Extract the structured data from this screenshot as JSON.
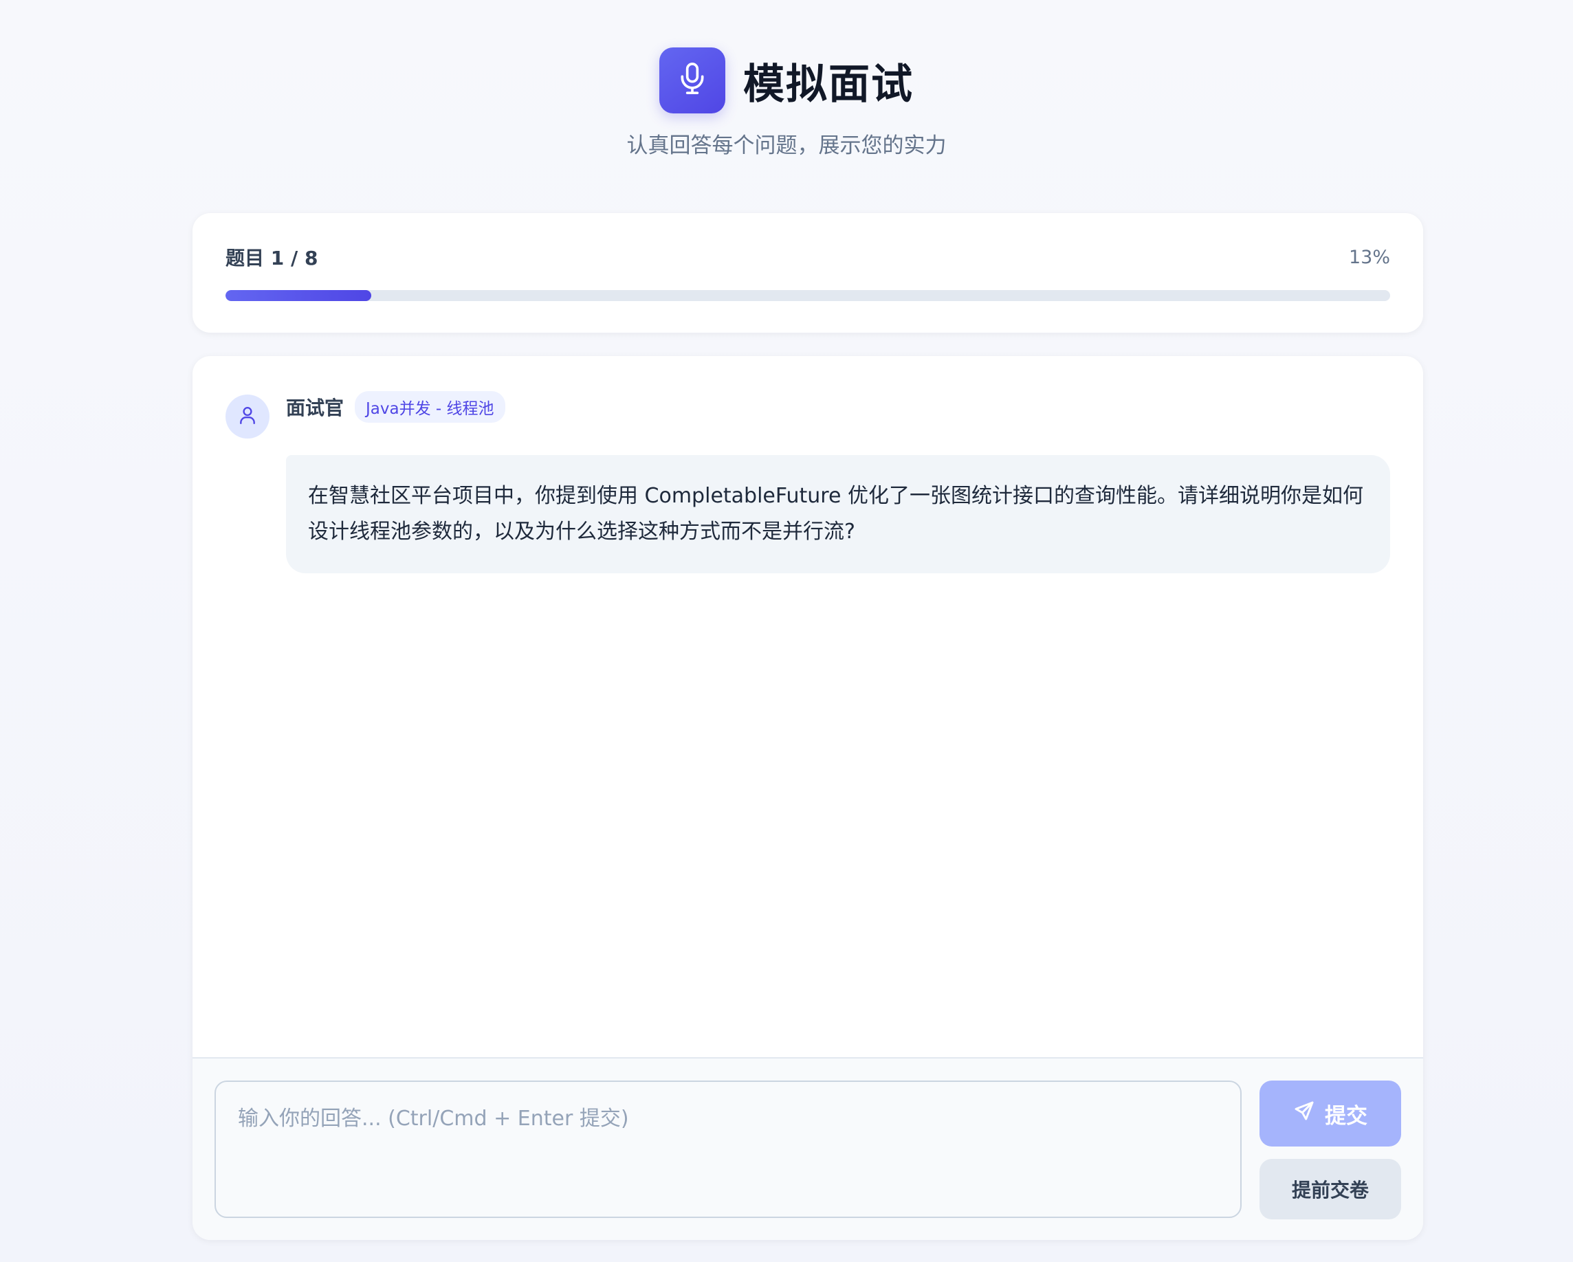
{
  "header": {
    "title": "模拟面试",
    "subtitle": "认真回答每个问题，展示您的实力",
    "logo_icon": "microphone-icon"
  },
  "progress": {
    "label": "题目 1 / 8",
    "current": 1,
    "total": 8,
    "percent_text": "13%",
    "fraction": 0.125
  },
  "message": {
    "avatar_icon": "user-icon",
    "sender": "面试官",
    "tag": "Java并发 - 线程池",
    "text": "在智慧社区平台项目中，你提到使用 CompletableFuture 优化了一张图统计接口的查询性能。请详细说明你是如何设计线程池参数的，以及为什么选择这种方式而不是并行流?"
  },
  "input": {
    "placeholder": "输入你的回答... (Ctrl/Cmd + Enter 提交)",
    "value": ""
  },
  "buttons": {
    "submit_label": "提交",
    "submit_icon": "send-icon",
    "early_submit_label": "提前交卷"
  },
  "colors": {
    "accent": "#4f46e5",
    "accent_light": "#a5b4fc",
    "background": "#f4f6fb",
    "track": "#e2e8f0"
  }
}
